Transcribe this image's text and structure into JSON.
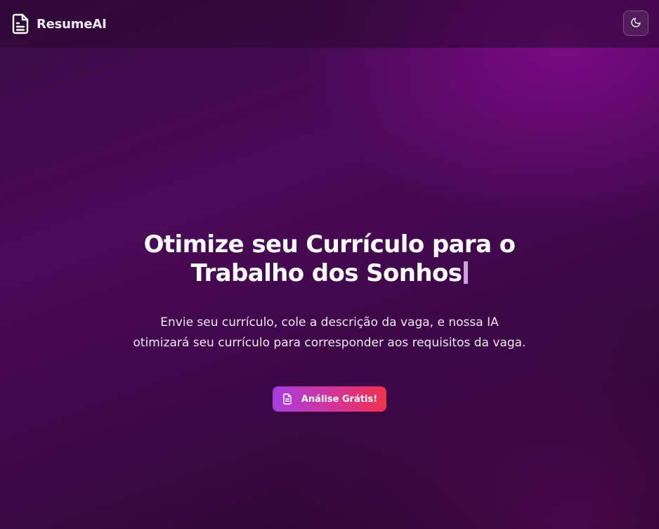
{
  "header": {
    "brand_name": "ResumeAI",
    "brand_icon": "file-text-icon",
    "theme_toggle_icon": "moon-icon"
  },
  "hero": {
    "title": "Otimize seu Currículo para o Trabalho dos Sonhos",
    "subtitle": "Envie seu currículo, cole a descrição da vaga, e nossa IA otimizará seu currículo para corresponder aos requisitos da vaga.",
    "cta_label": "Análise Grátis!",
    "cta_icon": "file-text-icon"
  },
  "colors": {
    "background_dark": "#2a0631",
    "background_accent": "#7a0a82",
    "cta_gradient_start": "#a63ee0",
    "cta_gradient_end": "#f0334c"
  }
}
